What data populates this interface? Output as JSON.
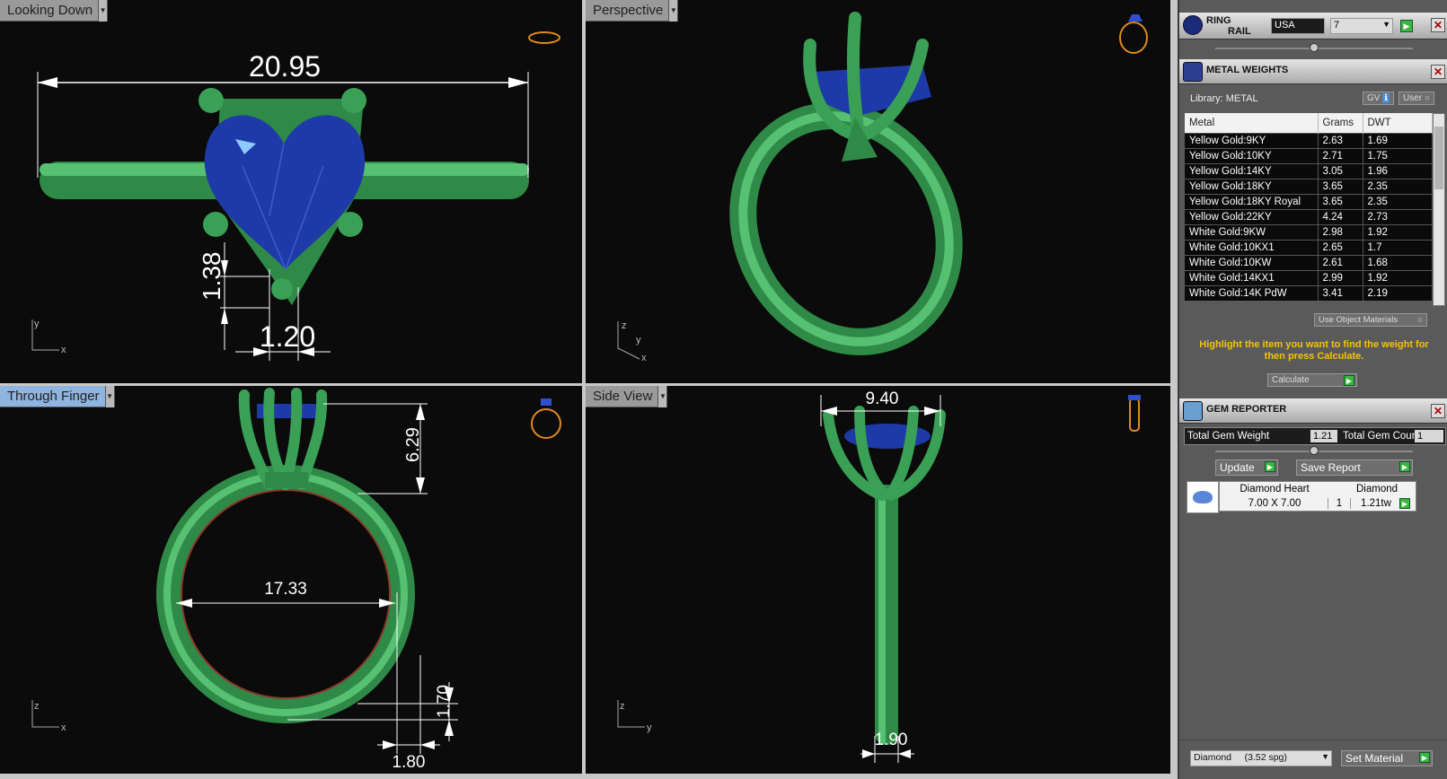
{
  "viewports": {
    "top_left": {
      "label": "Looking Down",
      "active": false,
      "dims": [
        "20.95",
        "1.38",
        "1.20"
      ],
      "axes": [
        "y",
        "x"
      ]
    },
    "top_right": {
      "label": "Perspective",
      "active": false,
      "axes": [
        "z",
        "y",
        "x"
      ]
    },
    "bottom_left": {
      "label": "Through Finger",
      "active": true,
      "dims": [
        "6.29",
        "17.33",
        "1.70",
        "1.80"
      ],
      "axes": [
        "z",
        "x"
      ]
    },
    "bottom_right": {
      "label": "Side View",
      "active": false,
      "dims": [
        "9.40",
        "1.90"
      ],
      "axes": [
        "z",
        "y"
      ]
    }
  },
  "ring_rail": {
    "title_line1": "RING",
    "title_line2": "RAIL",
    "country": "USA",
    "size": "7"
  },
  "metal_weights": {
    "title": "METAL WEIGHTS",
    "library": "Library: METAL",
    "gv": "GV",
    "user": "User",
    "columns": [
      "Metal",
      "Grams",
      "DWT"
    ],
    "rows": [
      [
        "Yellow Gold:9KY",
        "2.63",
        "1.69"
      ],
      [
        "Yellow Gold:10KY",
        "2.71",
        "1.75"
      ],
      [
        "Yellow Gold:14KY",
        "3.05",
        "1.96"
      ],
      [
        "Yellow Gold:18KY",
        "3.65",
        "2.35"
      ],
      [
        "Yellow Gold:18KY Royal",
        "3.65",
        "2.35"
      ],
      [
        "Yellow Gold:22KY",
        "4.24",
        "2.73"
      ],
      [
        "White Gold:9KW",
        "2.98",
        "1.92"
      ],
      [
        "White Gold:10KX1",
        "2.65",
        "1.7"
      ],
      [
        "White Gold:10KW",
        "2.61",
        "1.68"
      ],
      [
        "White Gold:14KX1",
        "2.99",
        "1.92"
      ],
      [
        "White Gold:14K PdW",
        "3.41",
        "2.19"
      ]
    ],
    "use_object_materials": "Use Object Materials",
    "hint": "Highlight the item you want to find the weight for then press Calculate.",
    "calculate": "Calculate"
  },
  "gem_reporter": {
    "title": "GEM REPORTER",
    "total_weight_label": "Total Gem Weight",
    "total_weight": "1.21",
    "total_count_label": "Total Gem Count",
    "total_count": "1",
    "update": "Update",
    "save_report": "Save Report",
    "col1": "Diamond Heart",
    "col2": "Diamond",
    "size": "7.00 X 7.00",
    "qty": "1",
    "tw": "1.21tw",
    "material_select": "Diamond     (3.52 spg)",
    "set_material": "Set Material"
  },
  "colors": {
    "metal": "#3aa055",
    "gem": "#1e3aa8",
    "viewport_bg": "#0b0b0b",
    "hint_text": "#f5c400"
  }
}
